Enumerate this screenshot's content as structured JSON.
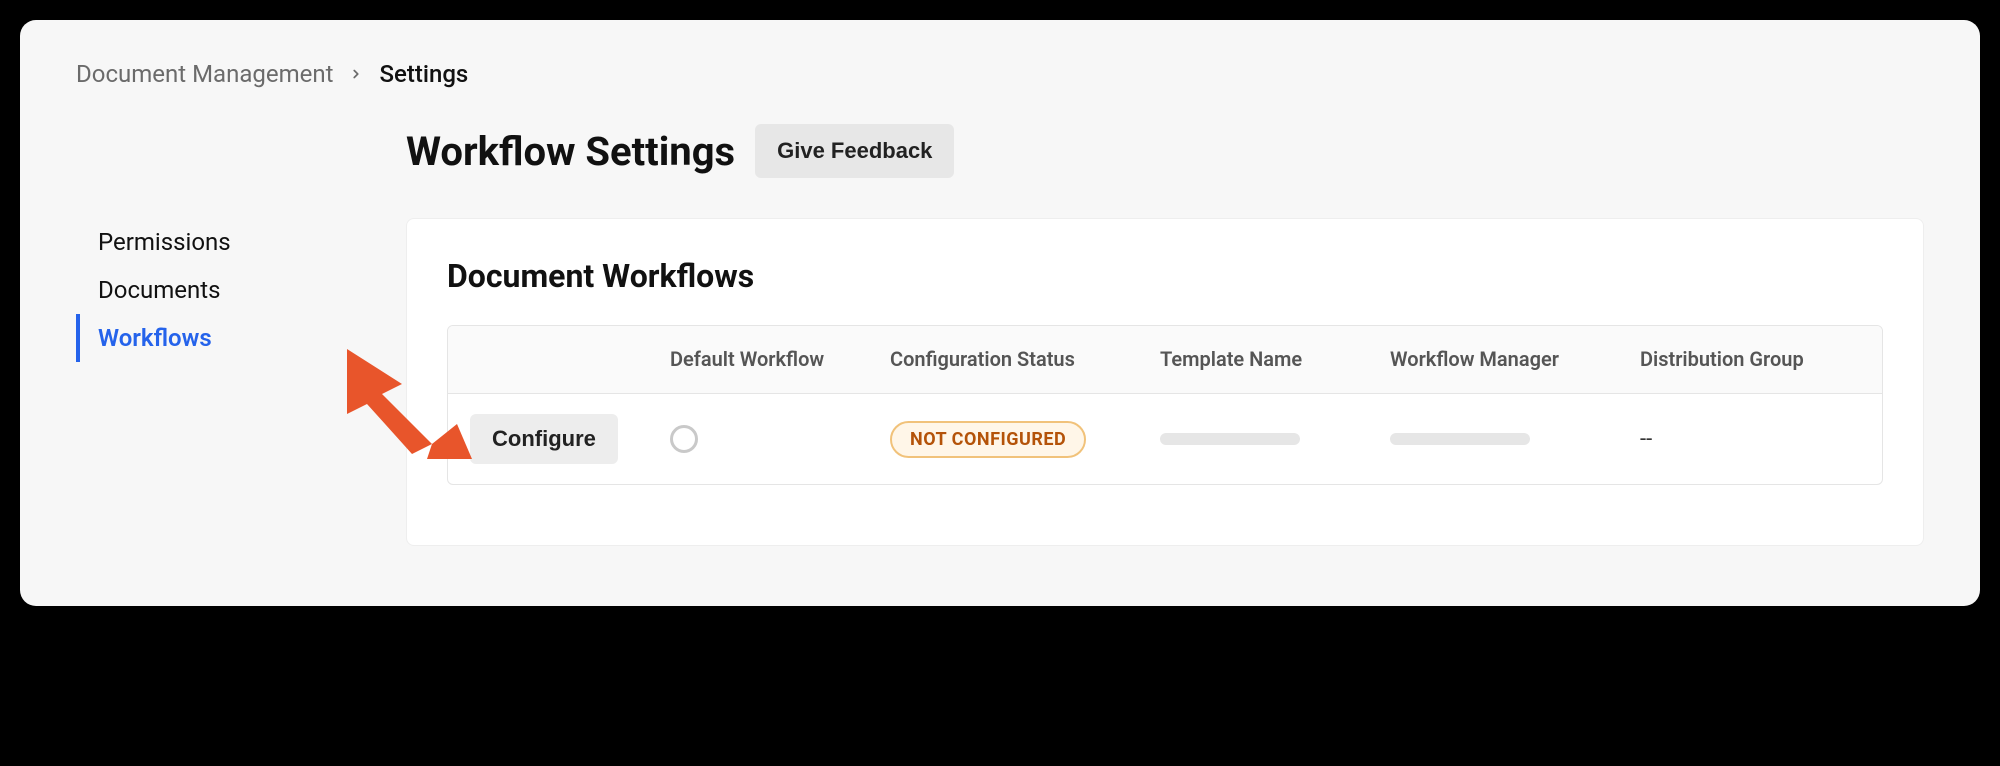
{
  "breadcrumb": {
    "parent": "Document Management",
    "current": "Settings"
  },
  "header": {
    "title": "Workflow Settings",
    "feedback_label": "Give Feedback"
  },
  "sidebar": {
    "items": [
      {
        "label": "Permissions",
        "active": false
      },
      {
        "label": "Documents",
        "active": false
      },
      {
        "label": "Workflows",
        "active": true
      }
    ]
  },
  "panel": {
    "title": "Document Workflows",
    "columns": {
      "action": "",
      "default_workflow": "Default Workflow",
      "configuration_status": "Configuration Status",
      "template_name": "Template Name",
      "workflow_manager": "Workflow Manager",
      "distribution_group": "Distribution Group"
    },
    "row": {
      "configure_label": "Configure",
      "status_label": "NOT CONFIGURED",
      "distribution_value": "--"
    }
  }
}
